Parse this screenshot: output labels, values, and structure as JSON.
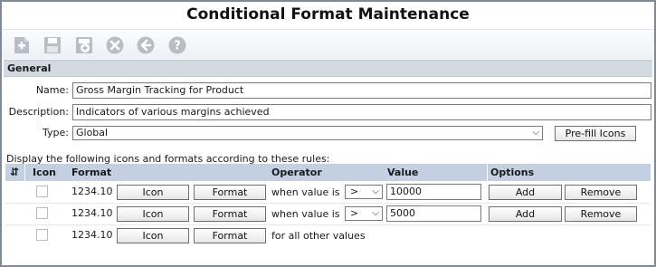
{
  "title": "Conditional Format Maintenance",
  "toolbar": {
    "icons": [
      "add-icon",
      "save-icon",
      "save-as-new-icon",
      "delete-icon",
      "back-icon",
      "help-icon"
    ]
  },
  "general": {
    "section_title": "General",
    "name_label": "Name:",
    "name_value": "Gross Margin Tracking for Product",
    "description_label": "Description:",
    "description_value": "Indicators of various margins achieved",
    "type_label": "Type:",
    "type_value": "Global",
    "prefill_button": "Pre-fill Icons"
  },
  "rules": {
    "intro": "Display the following icons and formats according to these rules:",
    "headers": {
      "sort": "⇵",
      "icon": "Icon",
      "format": "Format",
      "operator": "Operator",
      "value": "Value",
      "options": "Options"
    },
    "rows": [
      {
        "format_sample": "1234.10",
        "icon_button": "Icon",
        "format_button": "Format",
        "condition_text": "when value is",
        "operator": ">",
        "value": "10000",
        "add_button": "Add",
        "remove_button": "Remove"
      },
      {
        "format_sample": "1234.10",
        "icon_button": "Icon",
        "format_button": "Format",
        "condition_text": "when value is",
        "operator": ">",
        "value": "5000",
        "add_button": "Add",
        "remove_button": "Remove"
      },
      {
        "format_sample": "1234.10",
        "icon_button": "Icon",
        "format_button": "Format",
        "condition_text": "for all other values"
      }
    ]
  },
  "colors": {
    "toolbar_icon": "#b9bec6",
    "section_header": "#d3d9e1",
    "grid_header": "#c2d0e2",
    "window_border": "#7f8a99"
  }
}
